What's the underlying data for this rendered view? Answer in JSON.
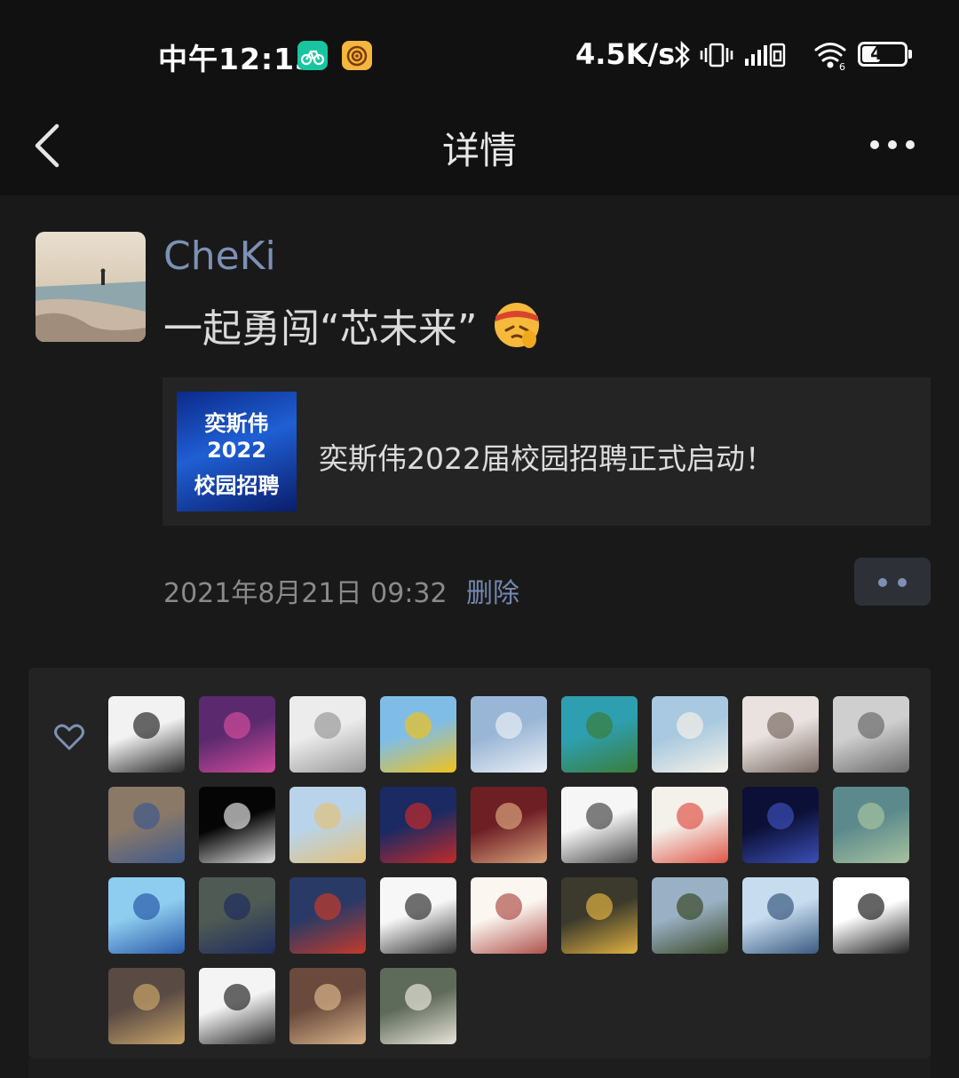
{
  "status_bar": {
    "time": "中午12:13",
    "net_speed": "4.5K/s",
    "battery": "44",
    "battery_fraction": 0.44
  },
  "nav": {
    "title": "详情",
    "back_icon": "chevron-left-icon",
    "more_icon": "more-horizontal-icon"
  },
  "post": {
    "username": "CheKi",
    "text": "一起勇闯“芯未来”",
    "emoji_icon": "face-with-headband-emoji",
    "share_card": {
      "thumb_lines": [
        "奕斯伟",
        "2022",
        "校园招聘"
      ],
      "title": "奕斯伟2022届校园招聘正式启动！"
    },
    "timestamp": "2021年8月21日 09:32",
    "delete_label": "删除"
  },
  "likes": {
    "icon": "heart-outline-icon",
    "avatars": [
      {
        "name": "liker-1",
        "colors": [
          "#f2f2f2",
          "#2b2b2b"
        ]
      },
      {
        "name": "liker-2",
        "colors": [
          "#5b2a6e",
          "#d14b9a"
        ]
      },
      {
        "name": "liker-3",
        "colors": [
          "#ececec",
          "#9a9a9a"
        ]
      },
      {
        "name": "liker-4",
        "colors": [
          "#7fbde6",
          "#f0c21c"
        ]
      },
      {
        "name": "liker-5",
        "colors": [
          "#9ab6d6",
          "#e8eef4"
        ]
      },
      {
        "name": "liker-6",
        "colors": [
          "#2e9fb0",
          "#3a7d3a"
        ]
      },
      {
        "name": "liker-7",
        "colors": [
          "#a8c9e0",
          "#f5f0e6"
        ]
      },
      {
        "name": "liker-8",
        "colors": [
          "#e9e2df",
          "#7a6b64"
        ]
      },
      {
        "name": "liker-9",
        "colors": [
          "#cfcfcf",
          "#6b6b6b"
        ]
      },
      {
        "name": "liker-10",
        "colors": [
          "#8b7968",
          "#3f5a8c"
        ]
      },
      {
        "name": "liker-11",
        "colors": [
          "#050505",
          "#e0e0e0"
        ]
      },
      {
        "name": "liker-12",
        "colors": [
          "#b9d4ea",
          "#e3c17a"
        ]
      },
      {
        "name": "liker-13",
        "colors": [
          "#1b2a63",
          "#c22a2a"
        ]
      },
      {
        "name": "liker-14",
        "colors": [
          "#6e1f24",
          "#d9a37c"
        ]
      },
      {
        "name": "liker-15",
        "colors": [
          "#f6f6f6",
          "#4a4a4a"
        ]
      },
      {
        "name": "liker-16",
        "colors": [
          "#f4f0ea",
          "#e05548"
        ]
      },
      {
        "name": "liker-17",
        "colors": [
          "#0c1036",
          "#3b4fb8"
        ]
      },
      {
        "name": "liker-18",
        "colors": [
          "#5c8a8c",
          "#a7c2a0"
        ]
      },
      {
        "name": "liker-19",
        "colors": [
          "#8ecdf0",
          "#2a5ba8"
        ]
      },
      {
        "name": "liker-20",
        "colors": [
          "#4f5a54",
          "#1f2c5e"
        ]
      },
      {
        "name": "liker-21",
        "colors": [
          "#2a3a66",
          "#c43a2a"
        ]
      },
      {
        "name": "liker-22",
        "colors": [
          "#f7f7f7",
          "#333333"
        ]
      },
      {
        "name": "liker-23",
        "colors": [
          "#fbf6f0",
          "#b0524c"
        ]
      },
      {
        "name": "liker-24",
        "colors": [
          "#3b3a2c",
          "#e0b040"
        ]
      },
      {
        "name": "liker-25",
        "colors": [
          "#9ab0c4",
          "#3b4a2a"
        ]
      },
      {
        "name": "liker-26",
        "colors": [
          "#c8dcef",
          "#3a5a80"
        ]
      },
      {
        "name": "liker-27",
        "colors": [
          "#ffffff",
          "#222222"
        ]
      },
      {
        "name": "liker-28",
        "colors": [
          "#5a4a44",
          "#c9a46a"
        ]
      },
      {
        "name": "liker-29",
        "colors": [
          "#f4f4f4",
          "#2a2a2a"
        ]
      },
      {
        "name": "liker-30",
        "colors": [
          "#6a4a3c",
          "#d9b48a"
        ]
      },
      {
        "name": "liker-31",
        "colors": [
          "#5f6b5a",
          "#e8e4da"
        ]
      }
    ]
  }
}
